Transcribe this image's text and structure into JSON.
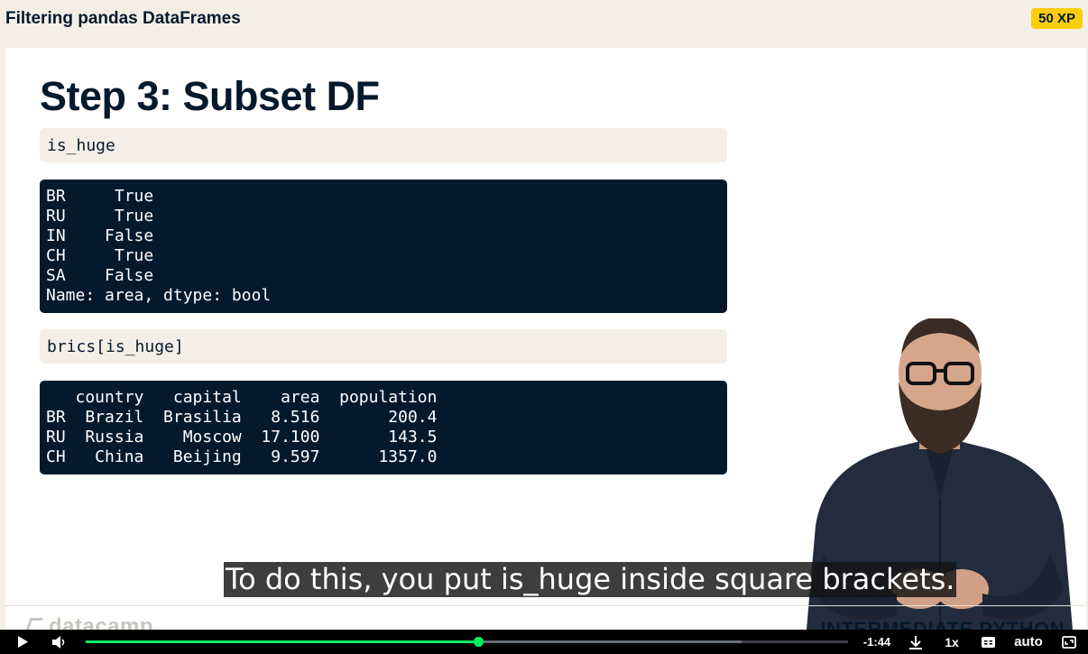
{
  "header": {
    "title": "Filtering pandas DataFrames",
    "xp_badge": "50 XP"
  },
  "slide": {
    "heading": "Step 3: Subset DF",
    "code_input_1": "is_huge",
    "output_1_lines": [
      "BR     True",
      "RU     True",
      "IN    False",
      "CH     True",
      "SA    False",
      "Name: area, dtype: bool"
    ],
    "code_input_2": "brics[is_huge]",
    "output_2_lines": [
      "   country   capital    area  population",
      "BR  Brazil  Brasilia   8.516       200.4",
      "RU  Russia    Moscow  17.100       143.5",
      "CH   China   Beijing   9.597      1357.0"
    ],
    "logo_text": "datacamp",
    "course_label": "INTERMEDIATE PYTHON"
  },
  "subtitle": "To do this, you put is_huge inside square brackets.",
  "player": {
    "time_remaining": "-1:44",
    "speed": "1x",
    "quality": "auto",
    "progress_played": 0.515,
    "progress_buffered": 0.86,
    "icons": [
      "play-icon",
      "volume-icon",
      "download-icon",
      "captions-icon",
      "fullscreen-icon"
    ]
  },
  "colors": {
    "navy": "#05192d",
    "green": "#03ef62",
    "xp_yellow": "#fcce0d",
    "beige": "#f4efe6"
  }
}
